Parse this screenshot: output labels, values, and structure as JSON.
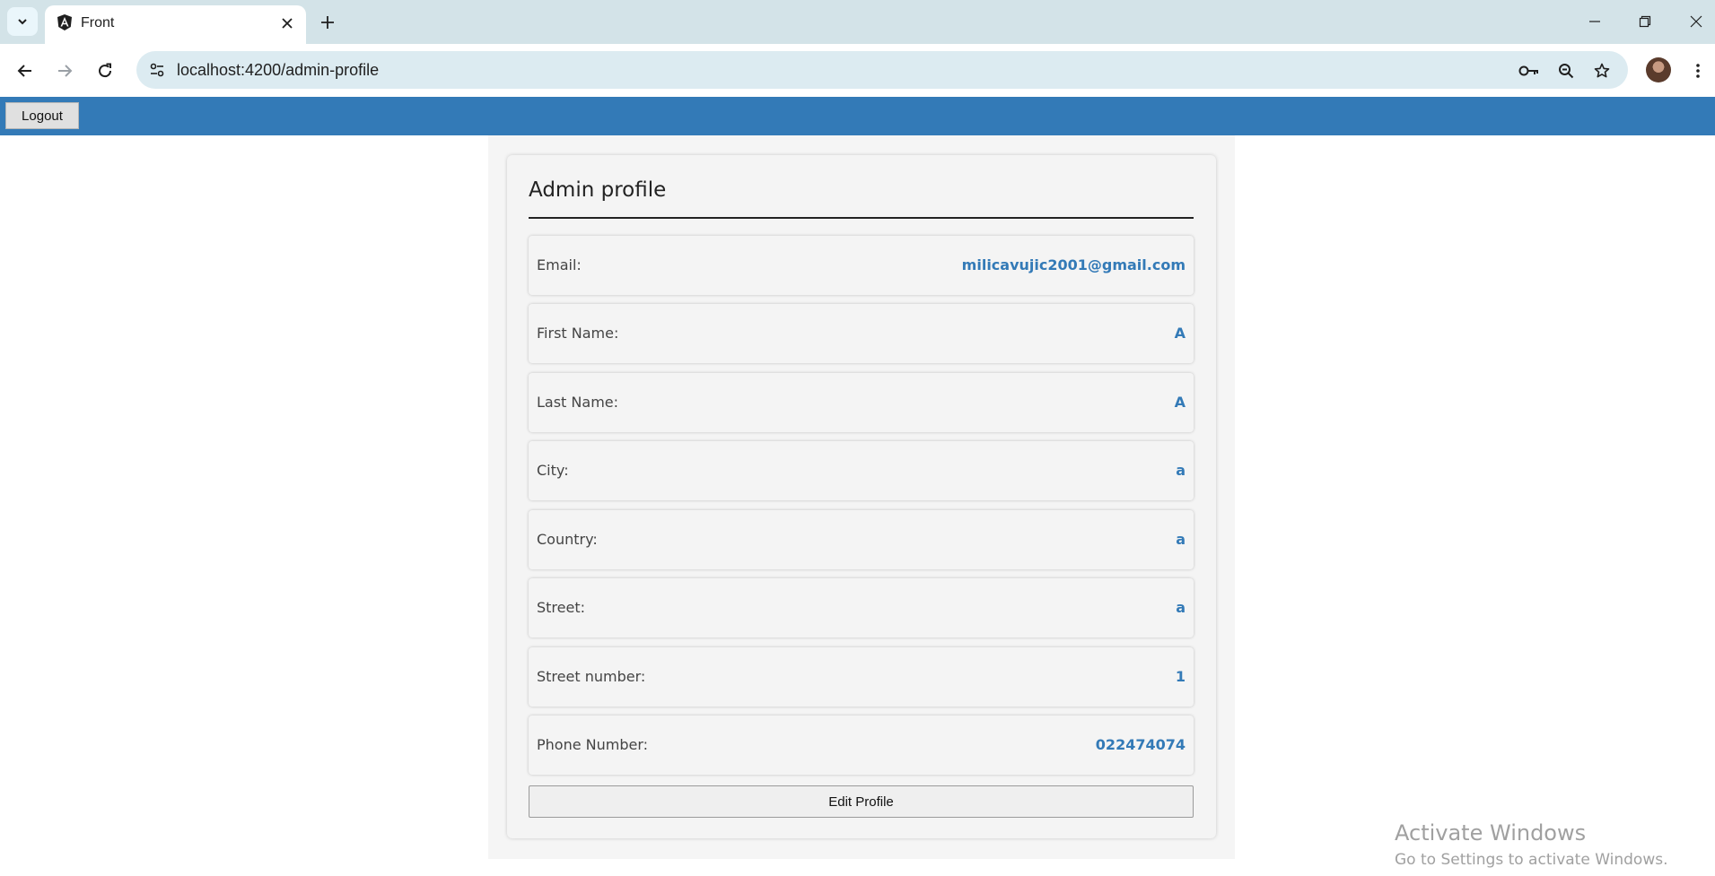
{
  "browser": {
    "tab_title": "Front",
    "url": "localhost:4200/admin-profile"
  },
  "header": {
    "logout_label": "Logout"
  },
  "profile": {
    "title": "Admin profile",
    "fields": [
      {
        "label": "Email:",
        "value": "milicavujic2001@gmail.com"
      },
      {
        "label": "First Name:",
        "value": "A"
      },
      {
        "label": "Last Name:",
        "value": "A"
      },
      {
        "label": "City:",
        "value": "a"
      },
      {
        "label": "Country:",
        "value": "a"
      },
      {
        "label": "Street:",
        "value": "a"
      },
      {
        "label": "Street number:",
        "value": "1"
      },
      {
        "label": "Phone Number:",
        "value": "022474074"
      }
    ],
    "edit_label": "Edit Profile"
  },
  "watermark": {
    "title": "Activate Windows",
    "subtitle": "Go to Settings to activate Windows."
  },
  "colors": {
    "accent": "#337ab7",
    "tabstrip": "#d3e3e8",
    "omnibox": "#dcebf1"
  }
}
